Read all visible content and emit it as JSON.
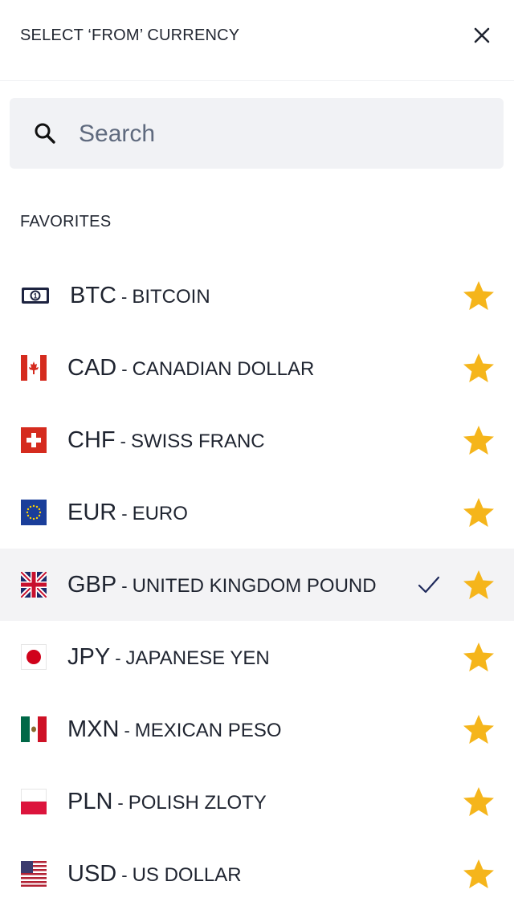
{
  "header": {
    "title": "SELECT ‘FROM’ CURRENCY"
  },
  "search": {
    "placeholder": "Search",
    "value": ""
  },
  "favorites": {
    "heading": "FAVORITES",
    "items": [
      {
        "code": "BTC",
        "separator": "-",
        "name": "BITCOIN",
        "flag": "bitcoin-banknote-icon",
        "starred": true,
        "selected": false
      },
      {
        "code": "CAD",
        "separator": "-",
        "name": "CANADIAN DOLLAR",
        "flag": "canada-flag-icon",
        "starred": true,
        "selected": false
      },
      {
        "code": "CHF",
        "separator": "-",
        "name": "SWISS FRANC",
        "flag": "switzerland-flag-icon",
        "starred": true,
        "selected": false
      },
      {
        "code": "EUR",
        "separator": "-",
        "name": "EURO",
        "flag": "eu-flag-icon",
        "starred": true,
        "selected": false
      },
      {
        "code": "GBP",
        "separator": "-",
        "name": "UNITED KINGDOM POUND",
        "flag": "uk-flag-icon",
        "starred": true,
        "selected": true
      },
      {
        "code": "JPY",
        "separator": "-",
        "name": "JAPANESE YEN",
        "flag": "japan-flag-icon",
        "starred": true,
        "selected": false
      },
      {
        "code": "MXN",
        "separator": "-",
        "name": "MEXICAN PESO",
        "flag": "mexico-flag-icon",
        "starred": true,
        "selected": false
      },
      {
        "code": "PLN",
        "separator": "-",
        "name": "POLISH ZLOTY",
        "flag": "poland-flag-icon",
        "starred": true,
        "selected": false
      },
      {
        "code": "USD",
        "separator": "-",
        "name": "US DOLLAR",
        "flag": "us-flag-icon",
        "starred": true,
        "selected": false
      }
    ]
  },
  "colors": {
    "star": "#f5b51b",
    "check": "#1f2a5c",
    "selected_row": "#f3f3f5",
    "search_bg": "#f1f2f5"
  }
}
